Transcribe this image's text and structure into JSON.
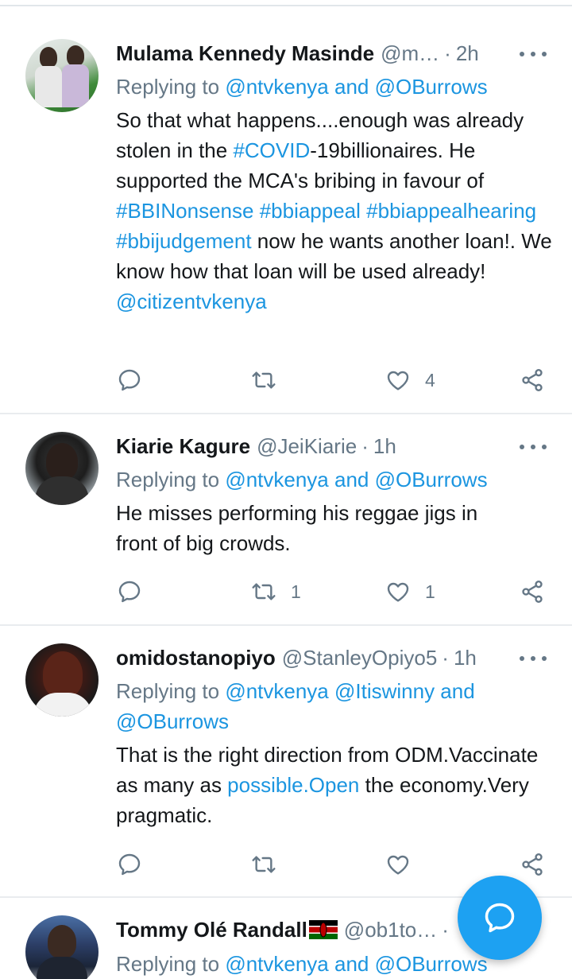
{
  "tweets": [
    {
      "name": "Mulama Kennedy Masinde",
      "handle": "@m…",
      "time": "2h",
      "reply_prefix": "Replying to",
      "reply_targets": "@ntvkenya and @OBurrows",
      "body": [
        {
          "t": "So that what happens....enough was already stolen in the ",
          "link": false
        },
        {
          "t": "#COVID",
          "link": true
        },
        {
          "t": "-19billionaires.  He supported the MCA's bribing in favour of ",
          "link": false
        },
        {
          "t": "#BBINonsense",
          "link": true
        },
        {
          "t": " ",
          "link": false
        },
        {
          "t": "#bbiappeal",
          "link": true
        },
        {
          "t": " ",
          "link": false
        },
        {
          "t": "#bbiappealhearing",
          "link": true
        },
        {
          "t": " ",
          "link": false
        },
        {
          "t": "#bbijudgement",
          "link": true
        },
        {
          "t": "  now he wants another loan!. We know how that loan will be used already! ",
          "link": false
        },
        {
          "t": "@citizentvkenya",
          "link": true
        }
      ],
      "retweets": "",
      "likes": "4"
    },
    {
      "name": "Kiarie Kagure",
      "handle": "@JeiKiarie",
      "time": "1h",
      "reply_prefix": "Replying to",
      "reply_targets": "@ntvkenya and @OBurrows",
      "body": [
        {
          "t": "He misses performing his reggae jigs in front of big crowds.",
          "link": false
        }
      ],
      "retweets": "1",
      "likes": "1"
    },
    {
      "name": "omidostanopiyo",
      "handle": "@StanleyOpiyo5",
      "time": "1h",
      "reply_prefix": "Replying to",
      "reply_targets": "@ntvkenya @Itiswinny and @OBurrows",
      "body": [
        {
          "t": "That is the right direction from ODM.Vaccinate as many as ",
          "link": false
        },
        {
          "t": "possible.Open",
          "link": true
        },
        {
          "t": " the economy.Very pragmatic.",
          "link": false
        }
      ],
      "retweets": "",
      "likes": ""
    },
    {
      "name": "Tommy Olé Randall",
      "handle": "@ob1to…",
      "time": "",
      "reply_prefix": "Replying to",
      "reply_targets": "@ntvkenya and @OBurrows",
      "body": [],
      "retweets": "",
      "likes": ""
    }
  ],
  "icons": {
    "reply": "reply-icon",
    "retweet": "retweet-icon",
    "like": "heart-icon",
    "share": "share-icon",
    "more": "more-icon",
    "compose": "compose-reply-icon"
  },
  "colors": {
    "accent": "#1da1f2",
    "link": "#1b95e0",
    "muted": "#657786",
    "text": "#14171a"
  }
}
